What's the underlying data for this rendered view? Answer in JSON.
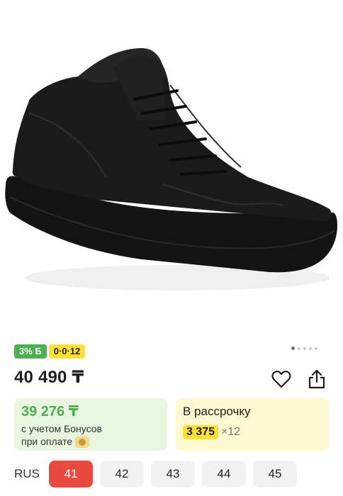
{
  "badges": {
    "bonus": "3% Б",
    "installment": "0·0·12"
  },
  "gallery": {
    "total": 5,
    "active": 1
  },
  "price": "40 490 ₸",
  "bonus_card": {
    "price": "39 276 ₸",
    "line1": "с учетом Бонусов",
    "line2": "при оплате"
  },
  "installment_card": {
    "title": "В рассрочку",
    "amount": "3 375",
    "multiplier": "×12"
  },
  "sizes": {
    "system": "RUS",
    "items": [
      {
        "label": "41",
        "selected": true
      },
      {
        "label": "42",
        "selected": false
      },
      {
        "label": "43",
        "selected": false
      },
      {
        "label": "44",
        "selected": false
      },
      {
        "label": "45",
        "selected": false
      }
    ]
  },
  "colors": {
    "accent_red": "#e84a3f",
    "bonus_green": "#4caf50",
    "installment_yellow": "#ffe033"
  },
  "icons": [
    "heart-icon",
    "share-icon",
    "coin-icon"
  ]
}
